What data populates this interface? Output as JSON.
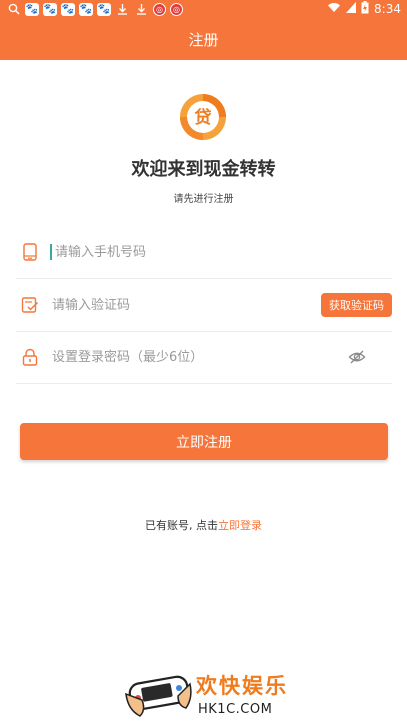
{
  "status_bar": {
    "time": "8:34",
    "left_icons": [
      "search-icon",
      "baidu-paw-icon",
      "baidu-paw-icon",
      "baidu-paw-icon",
      "baidu-paw-icon",
      "baidu-paw-icon",
      "download-icon",
      "download-icon",
      "red-app-icon",
      "red-app-icon"
    ],
    "right_icons": [
      "wifi-icon",
      "signal-icon",
      "battery-charging-icon"
    ]
  },
  "header": {
    "title": "注册"
  },
  "welcome": {
    "logo_char": "贷",
    "title": "欢迎来到现金转转",
    "subtitle": "请先进行注册"
  },
  "form": {
    "phone": {
      "placeholder": "请输入手机号码",
      "icon": "phone-icon"
    },
    "code": {
      "placeholder": "请输入验证码",
      "icon": "verify-icon",
      "button_label": "获取验证码"
    },
    "password": {
      "placeholder": "设置登录密码（最少6位）",
      "icon": "lock-icon",
      "toggle_icon": "eye-hidden-icon"
    },
    "submit_label": "立即注册"
  },
  "login_prompt": {
    "text": "已有账号, 点击",
    "link": "立即登录"
  },
  "watermark": {
    "text": "欢快娱乐",
    "url": "HK1C.COM"
  },
  "colors": {
    "accent": "#f5753a",
    "divider": "#ececec",
    "placeholder": "#9a9a9a"
  }
}
